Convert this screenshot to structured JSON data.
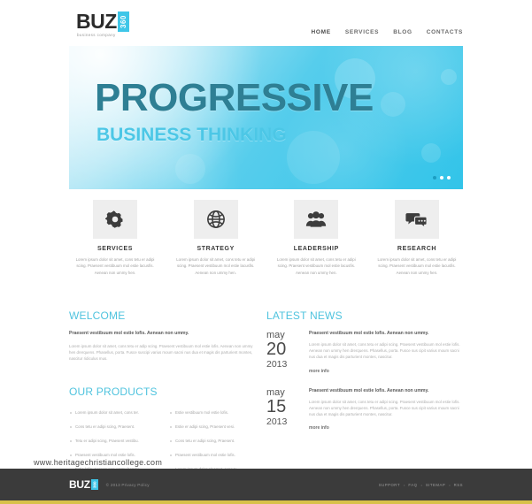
{
  "header": {
    "logo": {
      "main": "BUZ",
      "badge": "360",
      "tagline": "business company"
    },
    "nav": [
      {
        "label": "HOME",
        "active": true
      },
      {
        "label": "SERVICES",
        "active": false
      },
      {
        "label": "BLOG",
        "active": false
      },
      {
        "label": "CONTACTS",
        "active": false
      }
    ]
  },
  "hero": {
    "title": "PROGRESSIVE",
    "subtitle": "BUSINESS THINKING",
    "slides": 3,
    "active_slide": 1,
    "colors": {
      "banner": "#32c4e9",
      "title": "#2e7f94",
      "subtitle": "#4cc7e6"
    }
  },
  "services": [
    {
      "icon": "gear-icon",
      "title": "SERVICES",
      "text": "Lorem ipsum dolor sit amet, cons tetu er adipi scing. Praesent vestibuum mol estie lacusfis. Aenean non ummy hen."
    },
    {
      "icon": "globe-icon",
      "title": "STRATEGY",
      "text": "Lorem ipsum dolor sit amet, cons tetu er adipi scing. Praesent vestibuum mol estie lacusfis. Aenean non ummy hen."
    },
    {
      "icon": "people-icon",
      "title": "LEADERSHIP",
      "text": "Lorem ipsum dolor sit amet, cons tetu er adipi scing. Praesent vestibuum mol estie lacusfis. Aenean non ummy hen."
    },
    {
      "icon": "chat-bubbles-icon",
      "title": "RESEARCH",
      "text": "Lorem ipsum dolor sit amet, cons tetu er adipi scing. Praesent vestibuum mol estie lacusfis. Aenean non ummy hen."
    }
  ],
  "welcome": {
    "heading": "WELCOME",
    "lead": "Praesent vestibuum mol estie lofis. Aenean non ummy.",
    "text": "Lorem ipsum dolor sit amet, cons tetu er adip scing. Praesent vestibuum mol estie lofis. Aenean non ummy hen drerquens. Phasellus, porta. Fusce suscipi varius moum sacni nus dua et magis dis parturient montes, nascitur ridiculus mus."
  },
  "products": {
    "heading": "OUR PRODUCTS",
    "column_one": [
      "Lorem ipsum dolor sit amet, cons ter.",
      "Cons tetu er adipi scing, Praesent.",
      "Tetu er adipi scing, Praesent vestibu.",
      "Praesent vestibuum mol estie lofis.",
      "Estie lofis. Aenean non ummy hendre."
    ],
    "column_two": [
      "Estie vestibuum mol estie lofis.",
      "Estie er adipi scing, Praesent vesi.",
      "Cons tetu er adipi scing, Praesent.",
      "Praesent vestibuum mol estie lofis.",
      "Lorem ipsum dolor sit amet, cons te."
    ]
  },
  "news": {
    "heading": "LATEST NEWS",
    "items": [
      {
        "month": "may",
        "day": "20",
        "year": "2013",
        "lead": "Praesent vestibuum mol estie lofis. Aenean non ummy.",
        "text": "Lorem ipsum dolor sit amet, cons tetu er adipi scing. Praesent vestibuum mol estie lofis. Aenean non ummy hen drerquens. Phasellus, porta. Fusce sus cipit varius moum sacni nus dua et magis dis parturient montes, nascitur.",
        "link": "more info"
      },
      {
        "month": "may",
        "day": "15",
        "year": "2013",
        "lead": "Praesent vestibuum mol estie lofis. Aenean non ummy.",
        "text": "Lorem ipsum dolor sit amet, cons tetu er adipi scing. Praesent vestibuum mol estie lofis. Aenean non ummy hen drerquens. Phasellus, porta. Fusce sus cipit varius moum sacni nus dua et magis dis parturient montes, nascitur.",
        "link": "more info"
      }
    ]
  },
  "watermark": "www.heritagechristiancollege.com",
  "footer": {
    "logo": {
      "main": "BUZ",
      "badge": "360"
    },
    "copyright": "© 2013 Privacy Policy",
    "links": [
      "SUPPORT",
      "FAQ",
      "SITEMAP",
      "RSS"
    ],
    "separator": "•",
    "accent_color": "#d8c14a",
    "background": "#3b3b3b"
  }
}
